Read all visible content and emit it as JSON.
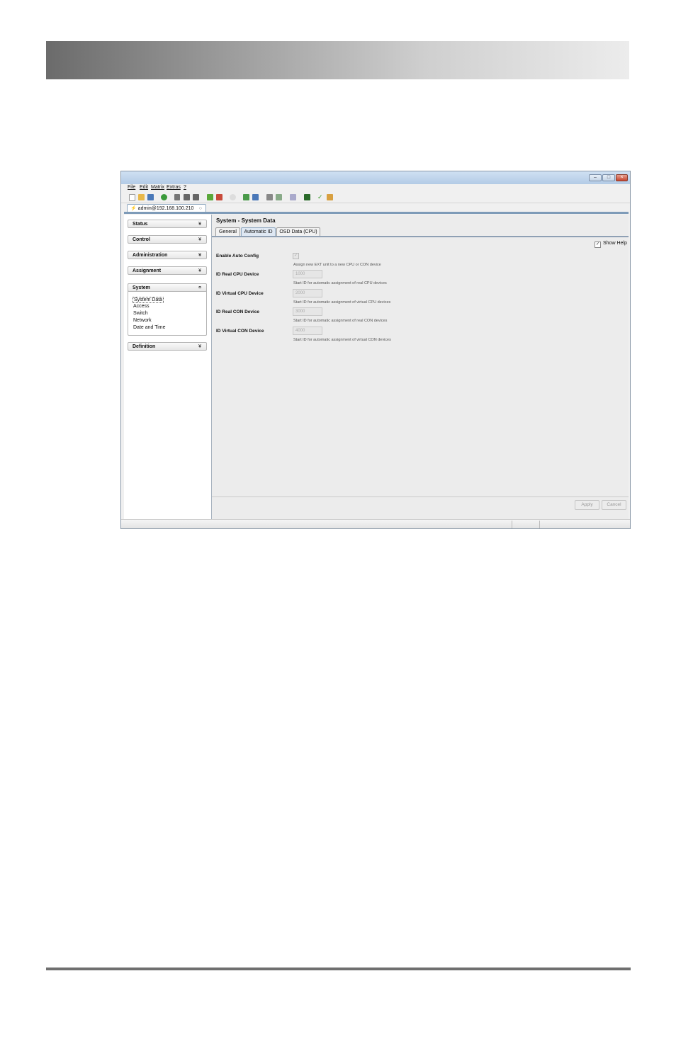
{
  "menu": {
    "items": [
      "File",
      "Edit",
      "Matrix",
      "Extras",
      "?"
    ]
  },
  "connection_tab": {
    "label": "admin@192.168.100.210"
  },
  "sidebar": {
    "sections": [
      {
        "label": "Status"
      },
      {
        "label": "Control"
      },
      {
        "label": "Administration"
      },
      {
        "label": "Assignment"
      },
      {
        "label": "System",
        "expanded": true,
        "items": [
          "System Data",
          "Access",
          "Switch",
          "Network",
          "Date and Time"
        ]
      },
      {
        "label": "Definition"
      }
    ]
  },
  "content": {
    "title": "System - System Data",
    "tabs": [
      "General",
      "Automatic ID",
      "OSD Data (CPU)"
    ],
    "active_tab": "Automatic ID",
    "show_help": {
      "label": "Show Help",
      "checked": true
    },
    "fields": [
      {
        "label": "Enable Auto Config",
        "type": "checkbox",
        "checked": true,
        "help": "Assign new EXT unit to a new CPU or CON device"
      },
      {
        "label": "ID Real CPU Device",
        "value": "1000",
        "help": "Start ID for automatic assignment of real CPU devices"
      },
      {
        "label": "ID Virtual CPU Device",
        "value": "2000",
        "help": "Start ID for automatic assignment of virtual CPU devices"
      },
      {
        "label": "ID Real CON Device",
        "value": "3000",
        "help": "Start ID for automatic assignment of real CON devices"
      },
      {
        "label": "ID Virtual CON Device",
        "value": "4000",
        "help": "Start ID for automatic assignment of virtual CON devices"
      }
    ],
    "buttons": {
      "apply": "Apply",
      "cancel": "Cancel"
    }
  },
  "glyphs": {
    "expand": "¥",
    "collapse": "¤",
    "check": "✓"
  },
  "colors": {
    "accent": "#7e9bb8",
    "close_button": "#c6452f"
  }
}
